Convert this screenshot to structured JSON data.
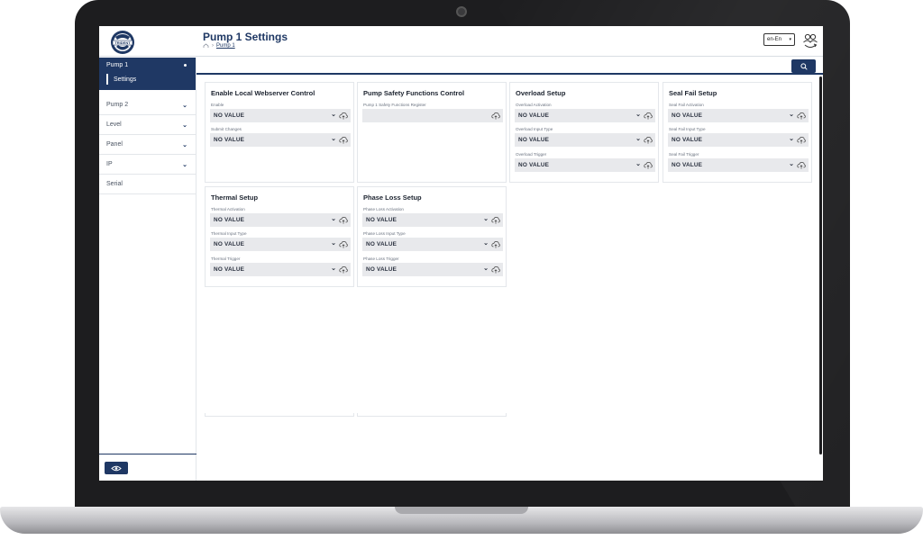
{
  "header": {
    "title": "Pump 1 Settings",
    "breadcrumb_current": "Pump 1",
    "language": "en-En",
    "logo_text": "TRIDENT"
  },
  "sidebar": {
    "items": [
      {
        "label": "Pump 1",
        "active": true,
        "children": [
          {
            "label": "Settings"
          }
        ]
      },
      {
        "label": "Pump 2",
        "chevron": true
      },
      {
        "label": "Level",
        "chevron": true
      },
      {
        "label": "Panel",
        "chevron": true
      },
      {
        "label": "IP",
        "chevron": true
      },
      {
        "label": "Serial",
        "chevron": false
      }
    ]
  },
  "colors": {
    "accent": "#1f3864",
    "field_bg": "#e8e9ec",
    "border": "#e4e7eb"
  },
  "icons": {
    "search": "search-icon",
    "eye": "eye-icon",
    "cloud": "cloud-sync-icon",
    "user": "user-switch-icon"
  },
  "cards": [
    {
      "title": "Enable Local Webserver Control",
      "fields": [
        {
          "label": "Enable",
          "value": "NO VALUE",
          "dropdown": true
        },
        {
          "label": "Submit Changes",
          "value": "NO VALUE",
          "dropdown": true
        }
      ]
    },
    {
      "title": "Pump Safety Functions Control",
      "fields": [
        {
          "label": "Pump 1 Safety Functions Register",
          "value": "",
          "dropdown": false
        }
      ]
    },
    {
      "title": "Overload Setup",
      "fields": [
        {
          "label": "Overload Activation",
          "value": "NO VALUE",
          "dropdown": true
        },
        {
          "label": "Overload Input Type",
          "value": "NO VALUE",
          "dropdown": true
        },
        {
          "label": "Overload Trigger",
          "value": "NO VALUE",
          "dropdown": true
        }
      ]
    },
    {
      "title": "Seal Fail Setup",
      "fields": [
        {
          "label": "Seal Fail Activation",
          "value": "NO VALUE",
          "dropdown": true
        },
        {
          "label": "Seal Fail Input Type",
          "value": "NO VALUE",
          "dropdown": true
        },
        {
          "label": "Seal Fail Trigger",
          "value": "NO VALUE",
          "dropdown": true
        }
      ]
    },
    {
      "title": "Thermal Setup",
      "fields": [
        {
          "label": "Thermal Activation",
          "value": "NO VALUE",
          "dropdown": true
        },
        {
          "label": "Thermal Input Type",
          "value": "NO VALUE",
          "dropdown": true
        },
        {
          "label": "Thermal Trigger",
          "value": "NO VALUE",
          "dropdown": true
        }
      ]
    },
    {
      "title": "Phase Loss Setup",
      "fields": [
        {
          "label": "Phase Loss Activation",
          "value": "NO VALUE",
          "dropdown": true
        },
        {
          "label": "Phase Loss Input Type",
          "value": "NO VALUE",
          "dropdown": true
        },
        {
          "label": "Phase Loss Trigger",
          "value": "NO VALUE",
          "dropdown": true
        }
      ]
    }
  ]
}
